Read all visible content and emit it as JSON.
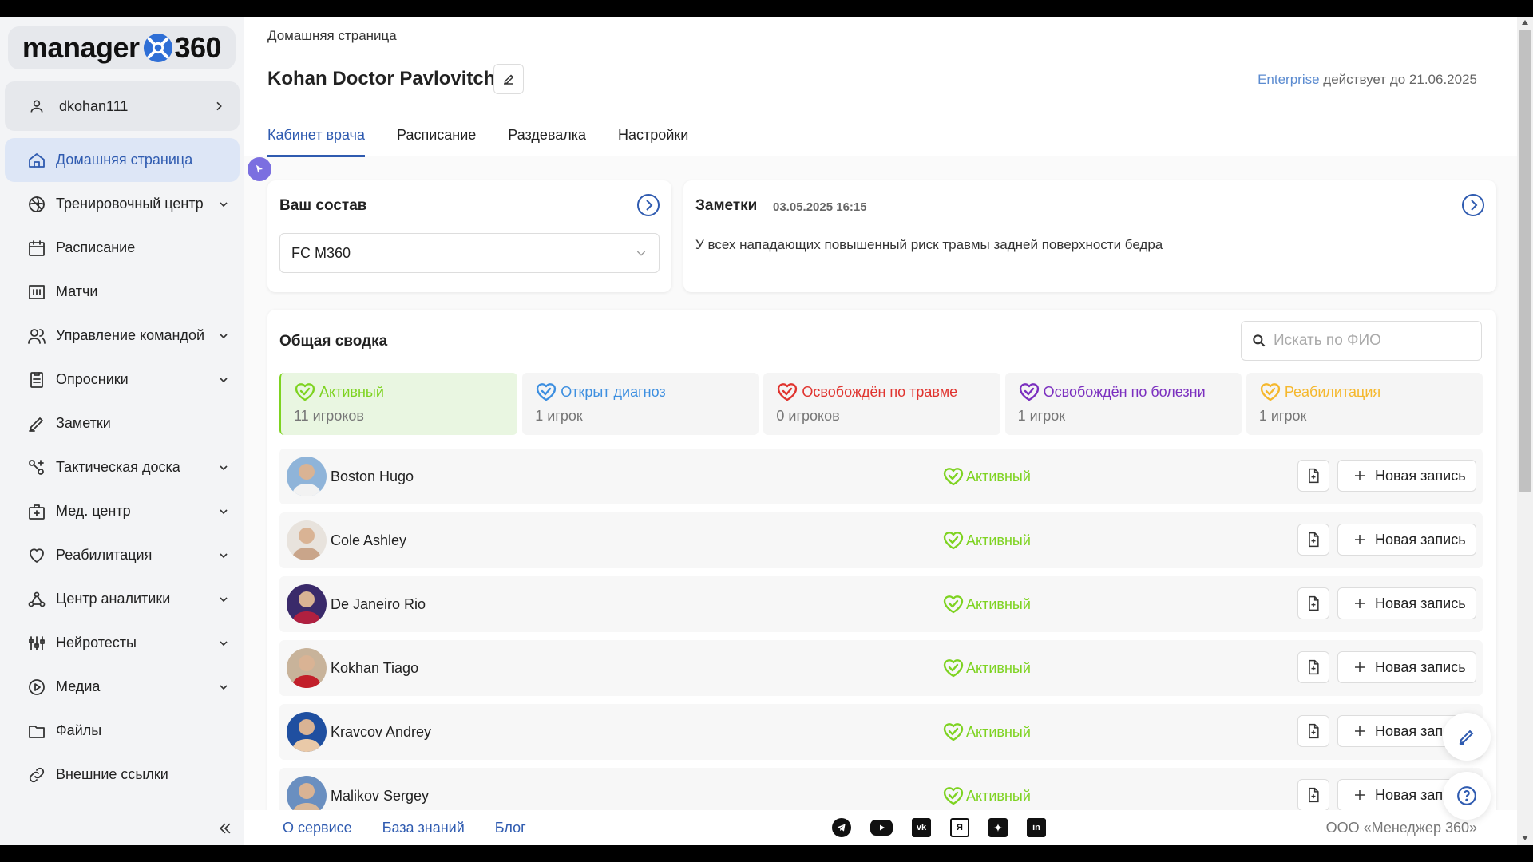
{
  "app": {
    "logo_word": "manager",
    "logo_number": "360"
  },
  "user": {
    "username": "dkohan111"
  },
  "sidebar": {
    "items": [
      {
        "label": "Домашняя страница",
        "icon": "home-icon",
        "expandable": false,
        "active": true
      },
      {
        "label": "Тренировочный центр",
        "icon": "ball-icon",
        "expandable": true
      },
      {
        "label": "Расписание",
        "icon": "calendar-icon",
        "expandable": false
      },
      {
        "label": "Матчи",
        "icon": "scoreboard-icon",
        "expandable": false
      },
      {
        "label": "Управление командой",
        "icon": "team-icon",
        "expandable": true
      },
      {
        "label": "Опросники",
        "icon": "survey-icon",
        "expandable": true
      },
      {
        "label": "Заметки",
        "icon": "pen-icon",
        "expandable": false
      },
      {
        "label": "Тактическая доска",
        "icon": "tactics-icon",
        "expandable": true
      },
      {
        "label": "Мед. центр",
        "icon": "medkit-icon",
        "expandable": true
      },
      {
        "label": "Реабилитация",
        "icon": "heart-icon",
        "expandable": true
      },
      {
        "label": "Центр аналитики",
        "icon": "analytics-icon",
        "expandable": true
      },
      {
        "label": "Нейротесты",
        "icon": "equalizer-icon",
        "expandable": true
      },
      {
        "label": "Медиа",
        "icon": "play-icon",
        "expandable": true
      },
      {
        "label": "Файлы",
        "icon": "folder-icon",
        "expandable": false
      },
      {
        "label": "Внешние ссылки",
        "icon": "link-icon",
        "expandable": false
      }
    ]
  },
  "header": {
    "breadcrumb": "Домашняя страница",
    "title": "Kohan Doctor Pavlovitch",
    "plan": "Enterprise",
    "plan_validity": "действует до 21.06.2025",
    "tabs": [
      {
        "label": "Кабинет врача",
        "active": true
      },
      {
        "label": "Расписание"
      },
      {
        "label": "Раздевалка"
      },
      {
        "label": "Настройки"
      }
    ]
  },
  "roster": {
    "title": "Ваш состав",
    "selected_team": "FC M360"
  },
  "notes": {
    "title": "Заметки",
    "date": "03.05.2025 16:15",
    "text": "У всех нападающих повышенный риск травмы задней поверхности бедра"
  },
  "summary": {
    "title": "Общая сводка",
    "search_placeholder": "Искать по ФИО",
    "stats": [
      {
        "label": "Активный",
        "count": "11 игроков",
        "color": "#7ed321",
        "active": true
      },
      {
        "label": "Открыт диагноз",
        "count": "1 игрок",
        "color": "#3d8fe0"
      },
      {
        "label": "Освобождён по травме",
        "count": "0 игроков",
        "color": "#e0342f"
      },
      {
        "label": "Освобождён по болезни",
        "count": "1 игрок",
        "color": "#7b2fbf"
      },
      {
        "label": "Реабилитация",
        "count": "1 игрок",
        "color": "#f5b82e"
      }
    ],
    "new_record_label": "Новая запись",
    "players": [
      {
        "name": "Boston Hugo",
        "status": "Активный"
      },
      {
        "name": "Cole Ashley",
        "status": "Активный"
      },
      {
        "name": "De Janeiro Rio",
        "status": "Активный"
      },
      {
        "name": "Kokhan Tiago",
        "status": "Активный"
      },
      {
        "name": "Kravcov Andrey",
        "status": "Активный"
      },
      {
        "name": "Malikov Sergey",
        "status": "Активный"
      }
    ]
  },
  "footer": {
    "links": [
      "О сервисе",
      "База знаний",
      "Блог"
    ],
    "socials": [
      "telegram-icon",
      "youtube-icon",
      "vk-icon",
      "yandex-zen-icon",
      "dzen-icon",
      "linkedin-icon"
    ],
    "company": "ООО «Менеджер 360»"
  },
  "colors": {
    "accent": "#2f5bb0",
    "active_green": "#7ed321"
  }
}
